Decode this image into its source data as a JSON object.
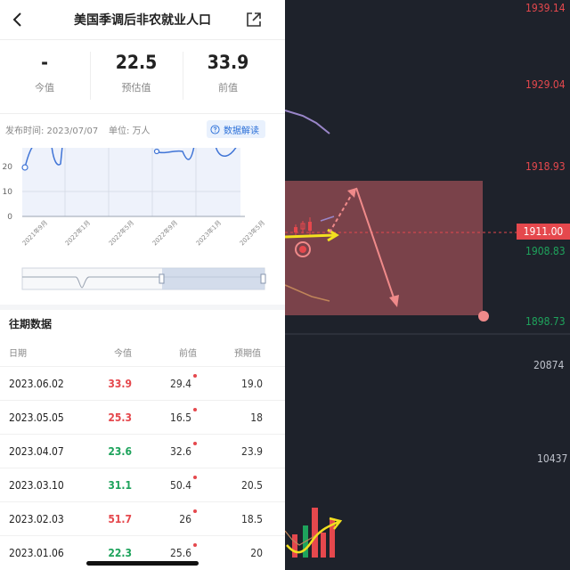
{
  "header": {
    "title": "美国季调后非农就业人口"
  },
  "stats": [
    {
      "value": "-",
      "label": "今值"
    },
    {
      "value": "22.5",
      "label": "预估值"
    },
    {
      "value": "33.9",
      "label": "前值"
    }
  ],
  "meta": {
    "publish_time": "发布时间: 2023/07/07",
    "unit": "单位: 万人",
    "interpret_label": "数据解读"
  },
  "mini_chart": {
    "y_ticks": [
      "20",
      "10",
      "0"
    ],
    "x_ticks": [
      "2021年9月",
      "2022年1月",
      "2022年5月",
      "2022年9月",
      "2023年1月",
      "2023年5月"
    ]
  },
  "history": {
    "title": "往期数据",
    "columns": [
      "日期",
      "今值",
      "前值",
      "预期值"
    ],
    "rows": [
      {
        "date": "2023.06.02",
        "actual": "33.9",
        "prev": "29.4",
        "forecast": "19.0",
        "color": "#e5484d",
        "revised": true
      },
      {
        "date": "2023.05.05",
        "actual": "25.3",
        "prev": "16.5",
        "forecast": "18",
        "color": "#e5484d",
        "revised": true
      },
      {
        "date": "2023.04.07",
        "actual": "23.6",
        "prev": "32.6",
        "forecast": "23.9",
        "color": "#1ea35c",
        "revised": true
      },
      {
        "date": "2023.03.10",
        "actual": "31.1",
        "prev": "50.4",
        "forecast": "20.5",
        "color": "#1ea35c",
        "revised": true
      },
      {
        "date": "2023.02.03",
        "actual": "51.7",
        "prev": "26",
        "forecast": "18.5",
        "color": "#e5484d",
        "revised": true
      },
      {
        "date": "2023.01.06",
        "actual": "22.3",
        "prev": "25.6",
        "forecast": "20",
        "color": "#1ea35c",
        "revised": true
      }
    ]
  },
  "price_axis": {
    "labels": [
      "1939.14",
      "1929.04",
      "1918.93",
      "1908.83",
      "1898.73"
    ],
    "current": "1911.00"
  },
  "volume_axis": {
    "labels": [
      "20874",
      "10437"
    ]
  },
  "colors": {
    "up": "#e5484d",
    "down": "#1ea35c",
    "accent": "#2a6fd8",
    "chart_bg": "#1e222b"
  }
}
